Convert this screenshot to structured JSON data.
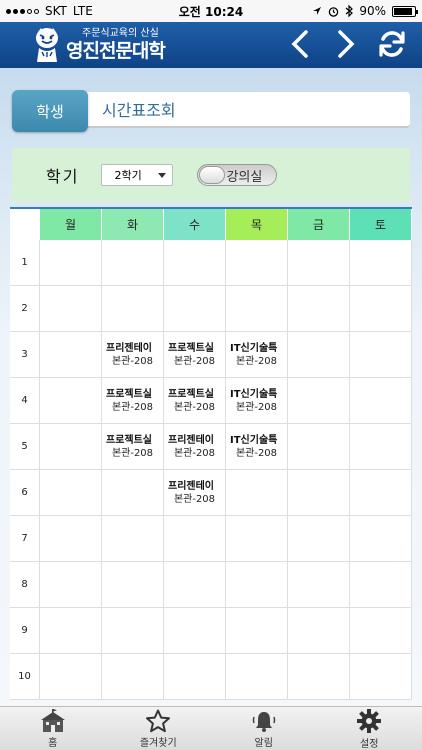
{
  "status": {
    "carrier": "SKT",
    "network": "LTE",
    "time": "오전 10:24",
    "battery": "90%",
    "battery_level": 0.9
  },
  "header": {
    "logo_subtitle": "주문식교육의 산실",
    "logo_title": "영진전문대학"
  },
  "breadcrumb": {
    "label": "학생",
    "title": "시간표조회"
  },
  "semester": {
    "label": "학기",
    "selected": "2학기",
    "toggle_label": "강의실"
  },
  "timetable": {
    "days": [
      "월",
      "화",
      "수",
      "목",
      "금",
      "토"
    ],
    "day_colors": [
      "#7fe8a6",
      "#8ee8b2",
      "#7ee3c6",
      "#a6ee59",
      "#7fe8a6",
      "#5ee0b7"
    ],
    "periods": [
      "1",
      "2",
      "3",
      "4",
      "5",
      "6",
      "7",
      "8",
      "9",
      "10"
    ],
    "entries": [
      {
        "period": 3,
        "day": 2,
        "course": "프리젠테이",
        "room": "본관-208"
      },
      {
        "period": 3,
        "day": 3,
        "course": "프로젝트실",
        "room": "본관-208"
      },
      {
        "period": 3,
        "day": 4,
        "course": "IT신기술특",
        "room": "본관-208"
      },
      {
        "period": 4,
        "day": 2,
        "course": "프로젝트실",
        "room": "본관-208"
      },
      {
        "period": 4,
        "day": 3,
        "course": "프로젝트실",
        "room": "본관-208"
      },
      {
        "period": 4,
        "day": 4,
        "course": "IT신기술특",
        "room": "본관-208"
      },
      {
        "period": 5,
        "day": 2,
        "course": "프로젝트실",
        "room": "본관-208"
      },
      {
        "period": 5,
        "day": 3,
        "course": "프리젠테이",
        "room": "본관-208"
      },
      {
        "period": 5,
        "day": 4,
        "course": "IT신기술특",
        "room": "본관-208"
      },
      {
        "period": 6,
        "day": 3,
        "course": "프리젠테이",
        "room": "본관-208"
      }
    ]
  },
  "tabs": [
    {
      "label": "홈",
      "icon": "school-icon"
    },
    {
      "label": "즐겨찾기",
      "icon": "star-icon"
    },
    {
      "label": "알림",
      "icon": "bell-icon"
    },
    {
      "label": "설정",
      "icon": "gear-icon"
    }
  ]
}
